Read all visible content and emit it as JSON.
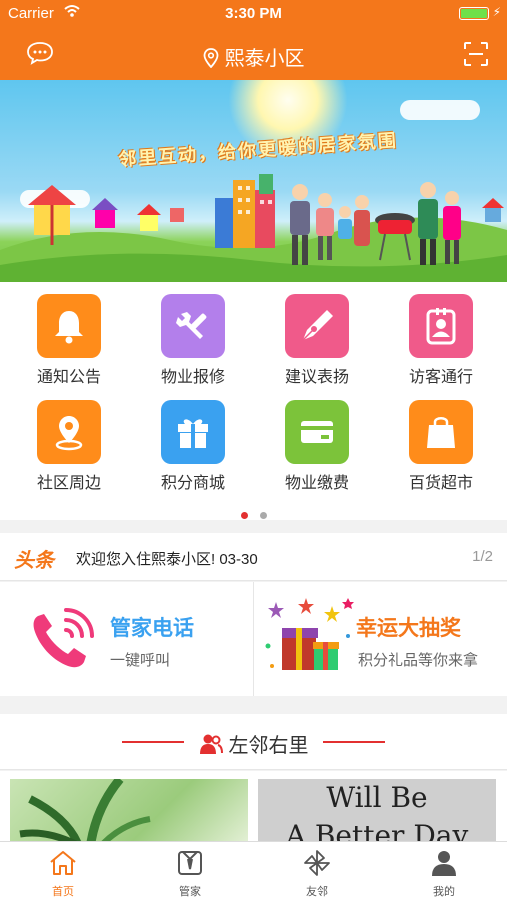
{
  "status": {
    "carrier": "Carrier",
    "time": "3:30 PM"
  },
  "nav": {
    "title": "熙泰小区"
  },
  "banner": {
    "slogan": "邻里互动，给你更暖的居家氛围"
  },
  "grid": {
    "items": [
      {
        "label": "通知公告",
        "color": "#ff8c1a",
        "icon": "bell-icon"
      },
      {
        "label": "物业报修",
        "color": "#b37feb",
        "icon": "wrench-icon"
      },
      {
        "label": "建议表扬",
        "color": "#f05a8a",
        "icon": "pen-icon"
      },
      {
        "label": "访客通行",
        "color": "#f05a8a",
        "icon": "badge-icon"
      },
      {
        "label": "社区周边",
        "color": "#ff8c1a",
        "icon": "location-icon"
      },
      {
        "label": "积分商城",
        "color": "#3aa1f0",
        "icon": "gift-icon"
      },
      {
        "label": "物业缴费",
        "color": "#7cc33a",
        "icon": "card-icon"
      },
      {
        "label": "百货超市",
        "color": "#ff8c1a",
        "icon": "bag-icon"
      }
    ]
  },
  "news": {
    "tag": "头条",
    "text": "欢迎您入住熙泰小区! 03-30",
    "page": "1/2"
  },
  "cards": {
    "phone": {
      "title": "管家电话",
      "subtitle": "一键呼叫",
      "color": "#3aa1f0"
    },
    "lottery": {
      "title": "幸运大抽奖",
      "subtitle": "积分礼品等你来拿",
      "color": "#f4771b"
    }
  },
  "neighbor": {
    "title": "左邻右里"
  },
  "photos": {
    "photo2_line1": "Will Be",
    "photo2_line2": "A Better Day"
  },
  "tabs": [
    {
      "label": "首页",
      "icon": "home-icon",
      "active": true
    },
    {
      "label": "管家",
      "icon": "butler-icon",
      "active": false
    },
    {
      "label": "友邻",
      "icon": "pinwheel-icon",
      "active": false
    },
    {
      "label": "我的",
      "icon": "person-icon",
      "active": false
    }
  ],
  "colors": {
    "brand": "#f4771b",
    "accent_red": "#e33030"
  }
}
